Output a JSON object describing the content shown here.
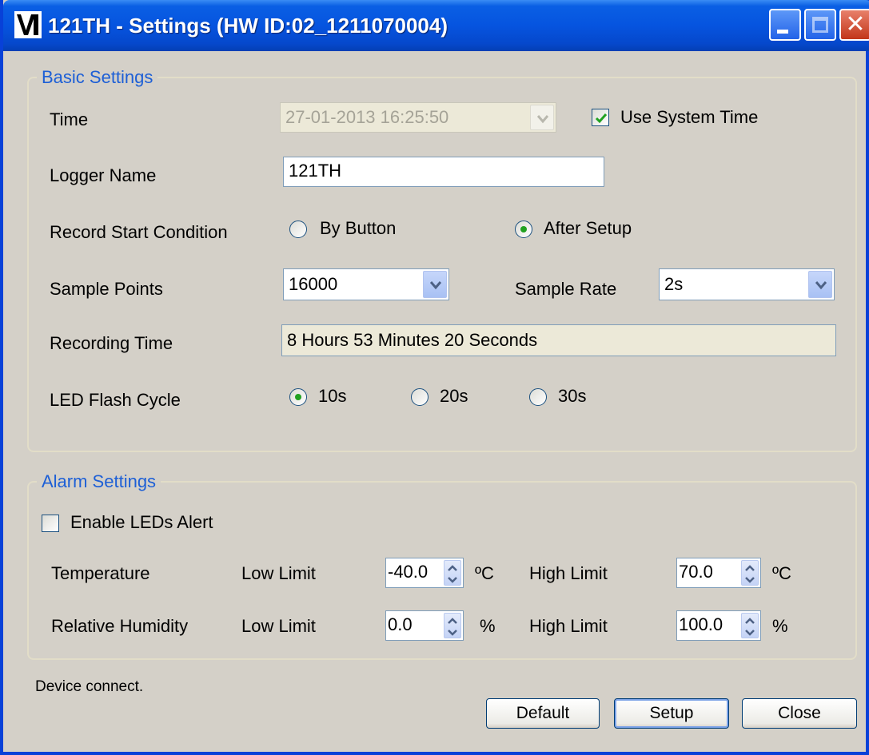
{
  "window": {
    "title": "121TH - Settings (HW ID:02_1211070004)"
  },
  "basic_settings": {
    "legend": "Basic Settings",
    "time": {
      "label": "Time",
      "value": "27-01-2013 16:25:50",
      "use_system_time_label": "Use System Time",
      "use_system_time_checked": true
    },
    "logger_name": {
      "label": "Logger Name",
      "value": "121TH"
    },
    "record_start": {
      "label": "Record Start Condition",
      "options": [
        "By Button",
        "After Setup"
      ],
      "selected": "After Setup"
    },
    "sample_points": {
      "label": "Sample Points",
      "value": "16000"
    },
    "sample_rate": {
      "label": "Sample Rate",
      "value": "2s"
    },
    "recording_time": {
      "label": "Recording Time",
      "value": "8 Hours 53 Minutes 20 Seconds"
    },
    "led_flash_cycle": {
      "label": "LED Flash Cycle",
      "options": [
        "10s",
        "20s",
        "30s"
      ],
      "selected": "10s"
    }
  },
  "alarm_settings": {
    "legend": "Alarm Settings",
    "enable_leds_alert": {
      "label": "Enable LEDs Alert",
      "checked": false
    },
    "temperature": {
      "label": "Temperature",
      "low_label": "Low Limit",
      "low_value": "-40.0",
      "low_unit": "ºC",
      "high_label": "High Limit",
      "high_value": "70.0",
      "high_unit": "ºC"
    },
    "humidity": {
      "label": "Relative Humidity",
      "low_label": "Low Limit",
      "low_value": "0.0",
      "low_unit": "%",
      "high_label": "High Limit",
      "high_value": "100.0",
      "high_unit": "%"
    }
  },
  "status": {
    "text": "Device connect."
  },
  "buttons": {
    "default": "Default",
    "setup": "Setup",
    "close": "Close"
  },
  "colors": {
    "titlebar": "#0654df",
    "legend": "#1d5fd6",
    "face": "#d4d0c8",
    "radio_dot": "#21a121",
    "check": "#21a121"
  },
  "icons": [
    "app-logo-icon",
    "minimize-icon",
    "maximize-icon",
    "close-icon",
    "dropdown-arrow-icon",
    "spin-up-icon",
    "spin-down-icon",
    "checkmark-icon"
  ]
}
